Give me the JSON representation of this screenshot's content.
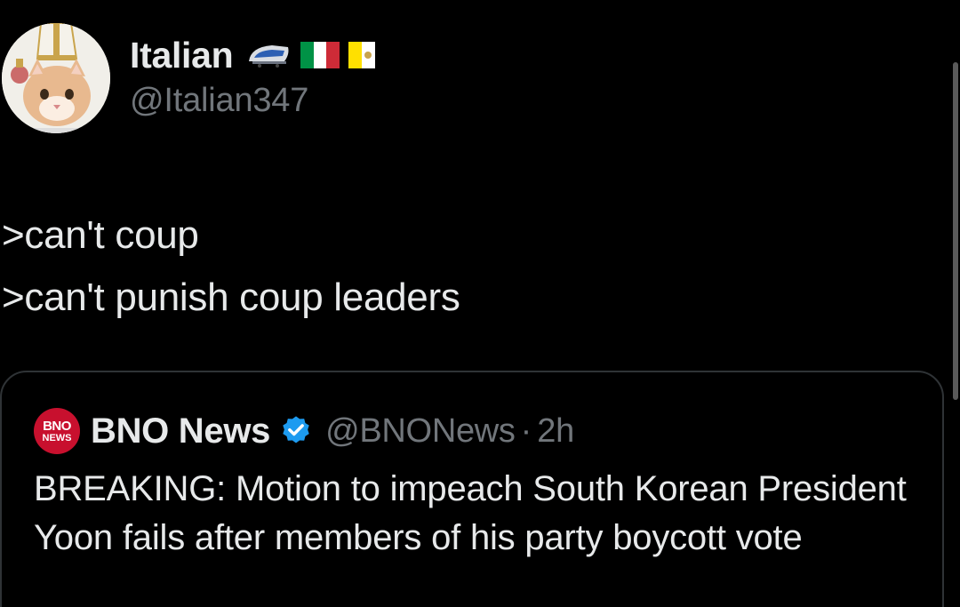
{
  "author": {
    "display_name": "Italian",
    "handle": "@Italian347",
    "emojis": [
      "train-icon",
      "italy-flag-icon",
      "vatican-flag-icon"
    ]
  },
  "tweet": {
    "lines": [
      ">can't coup",
      ">can't punish coup leaders"
    ]
  },
  "quote": {
    "logo": {
      "top": "BNO",
      "bottom": "NEWS"
    },
    "display_name": "BNO News",
    "verified": true,
    "handle": "@BNONews",
    "separator": "·",
    "time": "2h",
    "text": "BREAKING: Motion to impeach South Korean President Yoon fails after members of his party boycott vote"
  },
  "colors": {
    "background": "#000000",
    "text_primary": "#e7e9ea",
    "text_secondary": "#71767b",
    "card_border": "#2f3336",
    "verified_blue": "#1d9bf0",
    "bno_red": "#c8102e"
  }
}
